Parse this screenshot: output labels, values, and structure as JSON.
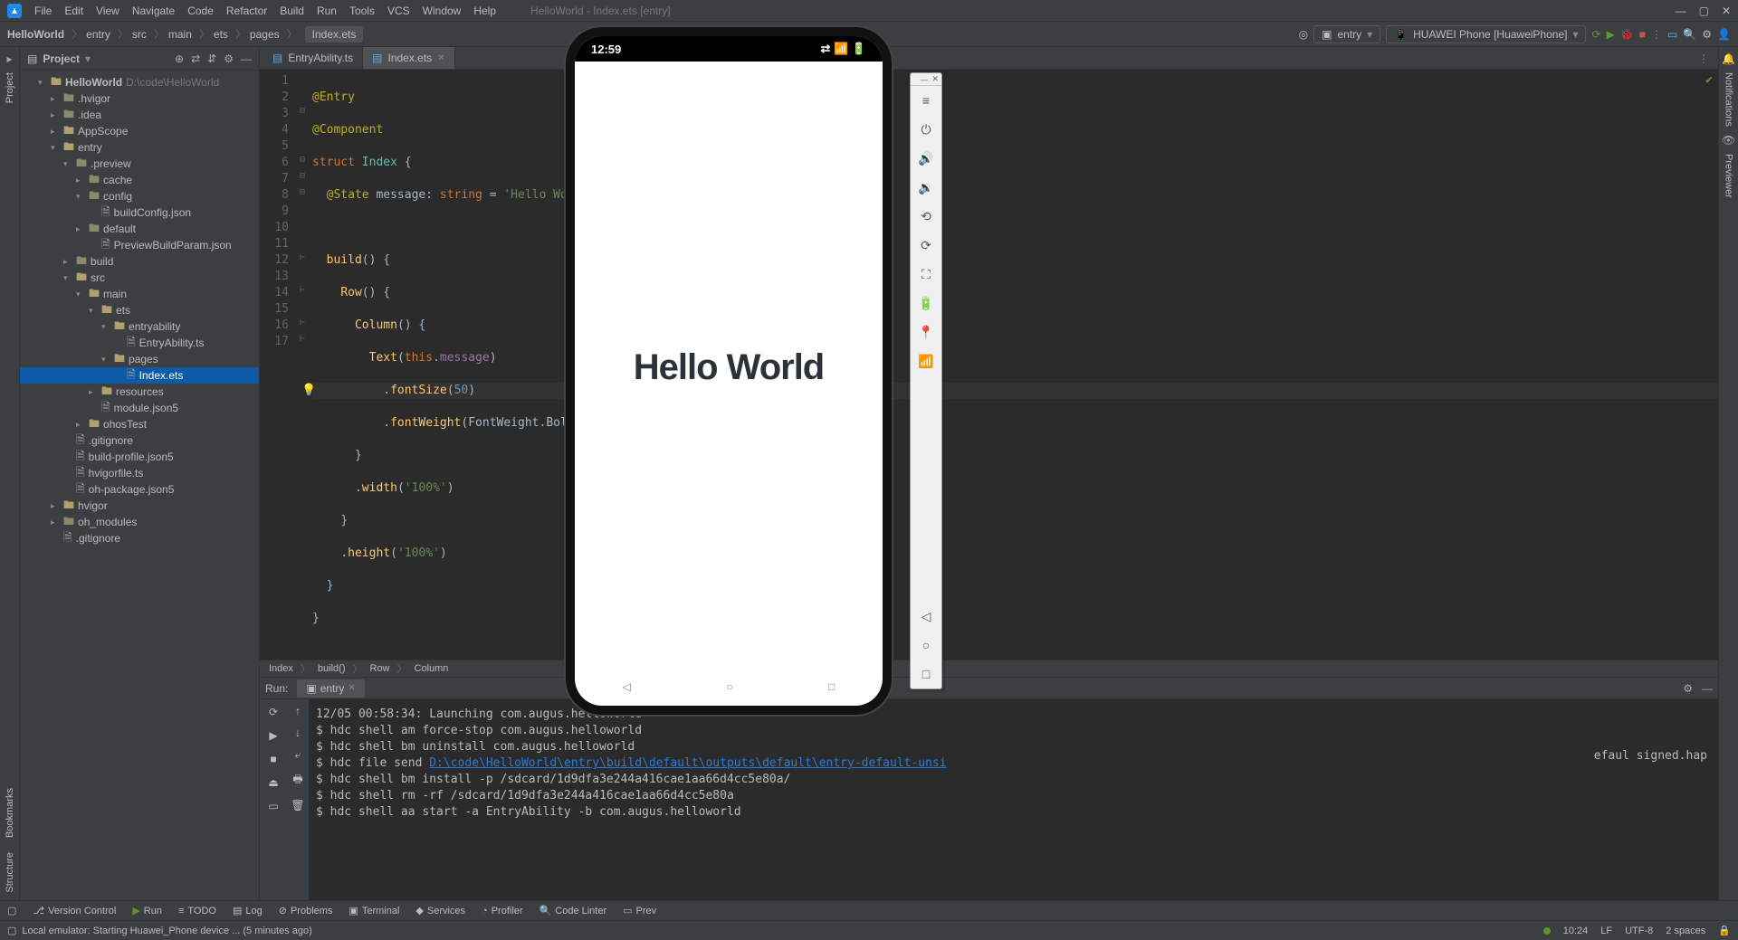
{
  "menubar": {
    "items": [
      "File",
      "Edit",
      "View",
      "Navigate",
      "Code",
      "Refactor",
      "Build",
      "Run",
      "Tools",
      "VCS",
      "Window",
      "Help"
    ],
    "title": "HelloWorld - Index.ets [entry]"
  },
  "navbar": {
    "project": "HelloWorld",
    "crumbs": [
      "entry",
      "src",
      "main",
      "ets",
      "pages"
    ],
    "file": "Index.ets",
    "run_config": "entry",
    "device": "HUAWEI Phone [HuaweiPhone]"
  },
  "project_panel": {
    "header": "Project",
    "root": "HelloWorld",
    "root_path": "D:\\code\\HelloWorld",
    "tree": [
      {
        "d": 1,
        "a": "v",
        "t": "f",
        "n": "HelloWorld",
        "extra": "D:\\code\\HelloWorld",
        "bold": true
      },
      {
        "d": 2,
        "a": ">",
        "t": "fd",
        "n": ".hvigor"
      },
      {
        "d": 2,
        "a": ">",
        "t": "fd",
        "n": ".idea"
      },
      {
        "d": 2,
        "a": ">",
        "t": "f",
        "n": "AppScope"
      },
      {
        "d": 2,
        "a": "v",
        "t": "f",
        "n": "entry"
      },
      {
        "d": 3,
        "a": "v",
        "t": "fh",
        "n": ".preview"
      },
      {
        "d": 4,
        "a": ">",
        "t": "fh",
        "n": "cache"
      },
      {
        "d": 4,
        "a": "v",
        "t": "fh",
        "n": "config"
      },
      {
        "d": 5,
        "a": "",
        "t": "file",
        "n": "buildConfig.json"
      },
      {
        "d": 4,
        "a": ">",
        "t": "fh",
        "n": "default"
      },
      {
        "d": 5,
        "a": "",
        "t": "file",
        "n": "PreviewBuildParam.json"
      },
      {
        "d": 3,
        "a": ">",
        "t": "fh",
        "n": "build"
      },
      {
        "d": 3,
        "a": "v",
        "t": "f",
        "n": "src"
      },
      {
        "d": 4,
        "a": "v",
        "t": "f",
        "n": "main"
      },
      {
        "d": 5,
        "a": "v",
        "t": "f",
        "n": "ets"
      },
      {
        "d": 6,
        "a": "v",
        "t": "f",
        "n": "entryability"
      },
      {
        "d": 7,
        "a": "",
        "t": "file",
        "n": "EntryAbility.ts"
      },
      {
        "d": 6,
        "a": "v",
        "t": "f",
        "n": "pages"
      },
      {
        "d": 7,
        "a": "",
        "t": "file",
        "n": "Index.ets",
        "sel": true
      },
      {
        "d": 5,
        "a": ">",
        "t": "f",
        "n": "resources"
      },
      {
        "d": 5,
        "a": "",
        "t": "file",
        "n": "module.json5"
      },
      {
        "d": 4,
        "a": ">",
        "t": "f",
        "n": "ohosTest"
      },
      {
        "d": 3,
        "a": "",
        "t": "file",
        "n": ".gitignore"
      },
      {
        "d": 3,
        "a": "",
        "t": "file",
        "n": "build-profile.json5"
      },
      {
        "d": 3,
        "a": "",
        "t": "file",
        "n": "hvigorfile.ts"
      },
      {
        "d": 3,
        "a": "",
        "t": "file",
        "n": "oh-package.json5"
      },
      {
        "d": 2,
        "a": ">",
        "t": "f",
        "n": "hvigor"
      },
      {
        "d": 2,
        "a": ">",
        "t": "fh",
        "n": "oh_modules"
      },
      {
        "d": 2,
        "a": "",
        "t": "file",
        "n": ".gitignore"
      }
    ]
  },
  "tabs": [
    {
      "label": "EntryAbility.ts",
      "active": false
    },
    {
      "label": "Index.ets",
      "active": true
    }
  ],
  "code": {
    "lines": 17,
    "breadcrumb": [
      "Index",
      "build()",
      "Row",
      "Column"
    ]
  },
  "run_panel": {
    "label": "Run:",
    "tab": "entry",
    "lines": [
      "12/05 00:58:34: Launching com.augus.helloworld",
      "$ hdc shell am force-stop com.augus.helloworld",
      "$ hdc shell bm uninstall com.augus.helloworld",
      "$ hdc file send ",
      "$ hdc shell bm install -p /sdcard/1d9dfa3e244a416cae1aa66d4cc5e80a/",
      "$ hdc shell rm -rf /sdcard/1d9dfa3e244a416cae1aa66d4cc5e80a",
      "$ hdc shell aa start -a EntryAbility -b com.augus.helloworld"
    ],
    "link": "D:\\code\\HelloWorld\\entry\\build\\default\\outputs\\default\\entry-default-unsi",
    "right_text": "efaul     signed.hap"
  },
  "toolwin": {
    "items": [
      "Version Control",
      "Run",
      "TODO",
      "Log",
      "Problems",
      "Terminal",
      "Services",
      "Profiler",
      "Code Linter",
      "Prev"
    ]
  },
  "statusbar": {
    "msg": "Local emulator: Starting Huawei_Phone device ... (5 minutes ago)",
    "time": "10:24",
    "enc": "LF",
    "charset": "UTF-8",
    "indent": "2 spaces"
  },
  "phone": {
    "time": "12:59",
    "message": "Hello World"
  },
  "sidebar_left": [
    "Project",
    "Bookmarks",
    "Structure"
  ],
  "sidebar_right": [
    "Notifications",
    "Previewer"
  ]
}
